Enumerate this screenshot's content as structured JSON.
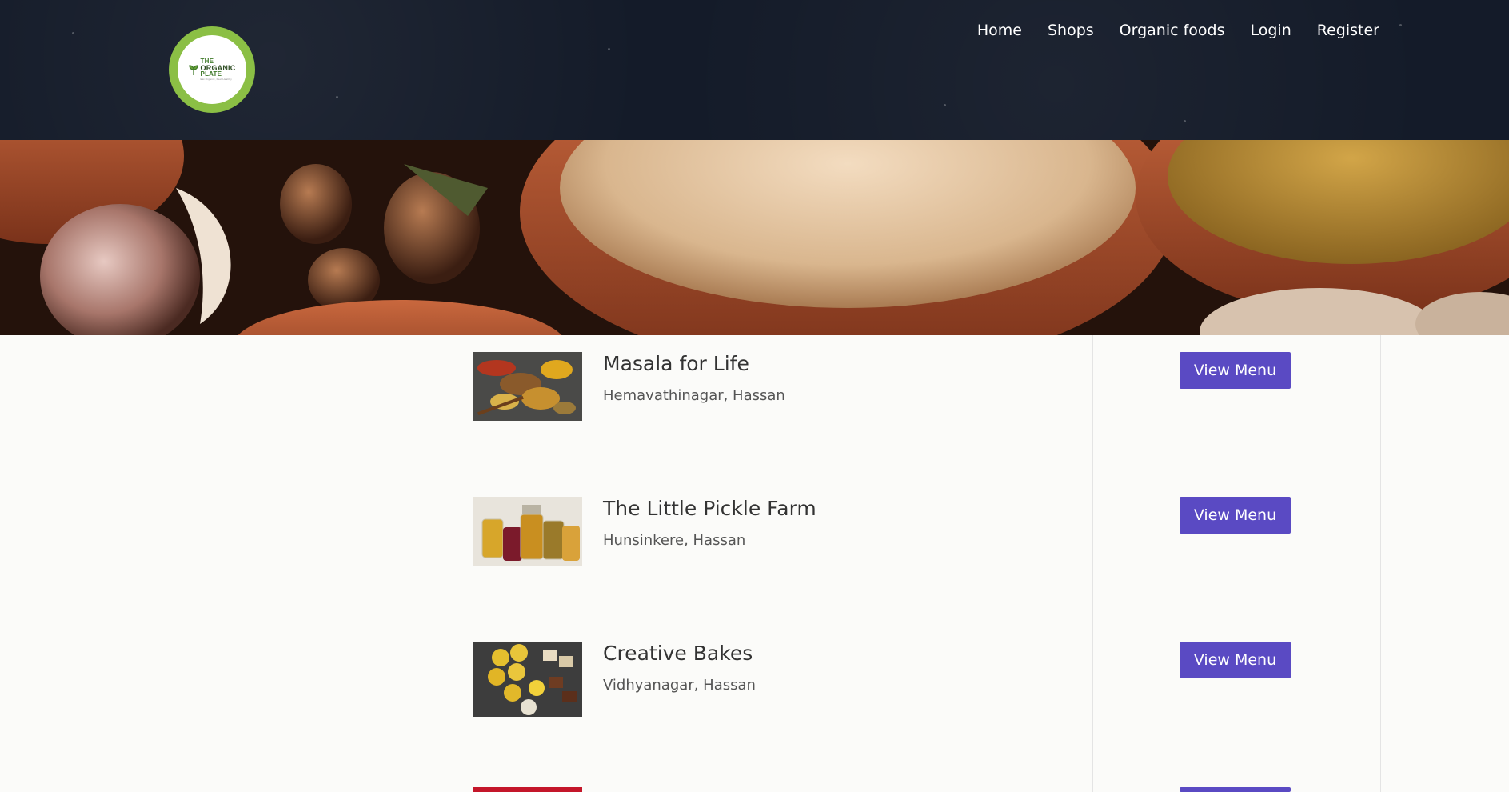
{
  "header": {
    "logo": {
      "line1": "THE",
      "line2": "ORGANIC",
      "line3": "PLATE",
      "tagline": "Eat Organic, Feel Healthy"
    },
    "nav": [
      "Home",
      "Shops",
      "Organic foods",
      "Login",
      "Register"
    ]
  },
  "shops": [
    {
      "name": "Masala for Life",
      "location": "Hemavathinagar, Hassan",
      "button": "View Menu",
      "thumb_icon": "spices-photo"
    },
    {
      "name": "The Little Pickle Farm",
      "location": "Hunsinkere, Hassan",
      "button": "View Menu",
      "thumb_icon": "pickle-jars-photo"
    },
    {
      "name": "Creative Bakes",
      "location": "Vidhyanagar, Hassan",
      "button": "View Menu",
      "thumb_icon": "sweets-photo"
    },
    {
      "name": "",
      "location": "",
      "button": "",
      "thumb_icon": "partial-photo"
    }
  ],
  "colors": {
    "header_bg": "#141b29",
    "accent": "#5a4ac3",
    "logo_ring": "#8bbf45"
  }
}
